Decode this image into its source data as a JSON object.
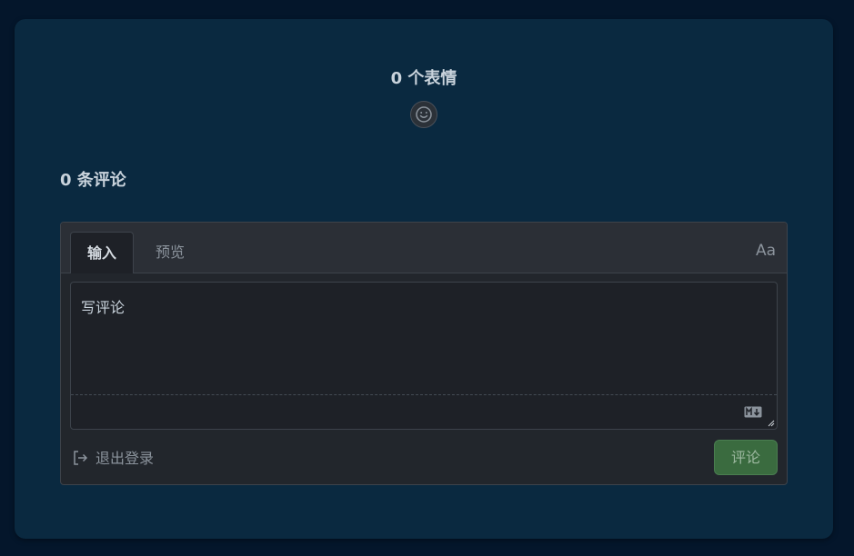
{
  "reactions": {
    "count_label": "0 个表情",
    "add_icon": "smiley-face-icon"
  },
  "comments": {
    "count_label": "0 条评论"
  },
  "editor": {
    "tabs": [
      {
        "label": "输入",
        "selected": true
      },
      {
        "label": "预览",
        "selected": false
      }
    ],
    "font_toggle_label": "Aa",
    "placeholder": "写评论",
    "markdown_icon": "markdown-icon"
  },
  "footer": {
    "logout_label": "退出登录",
    "logout_icon": "sign-out-icon",
    "submit_label": "评论"
  },
  "colors": {
    "background": "#04162b",
    "card": "#0a2940",
    "submit": "#3a6b3f"
  }
}
